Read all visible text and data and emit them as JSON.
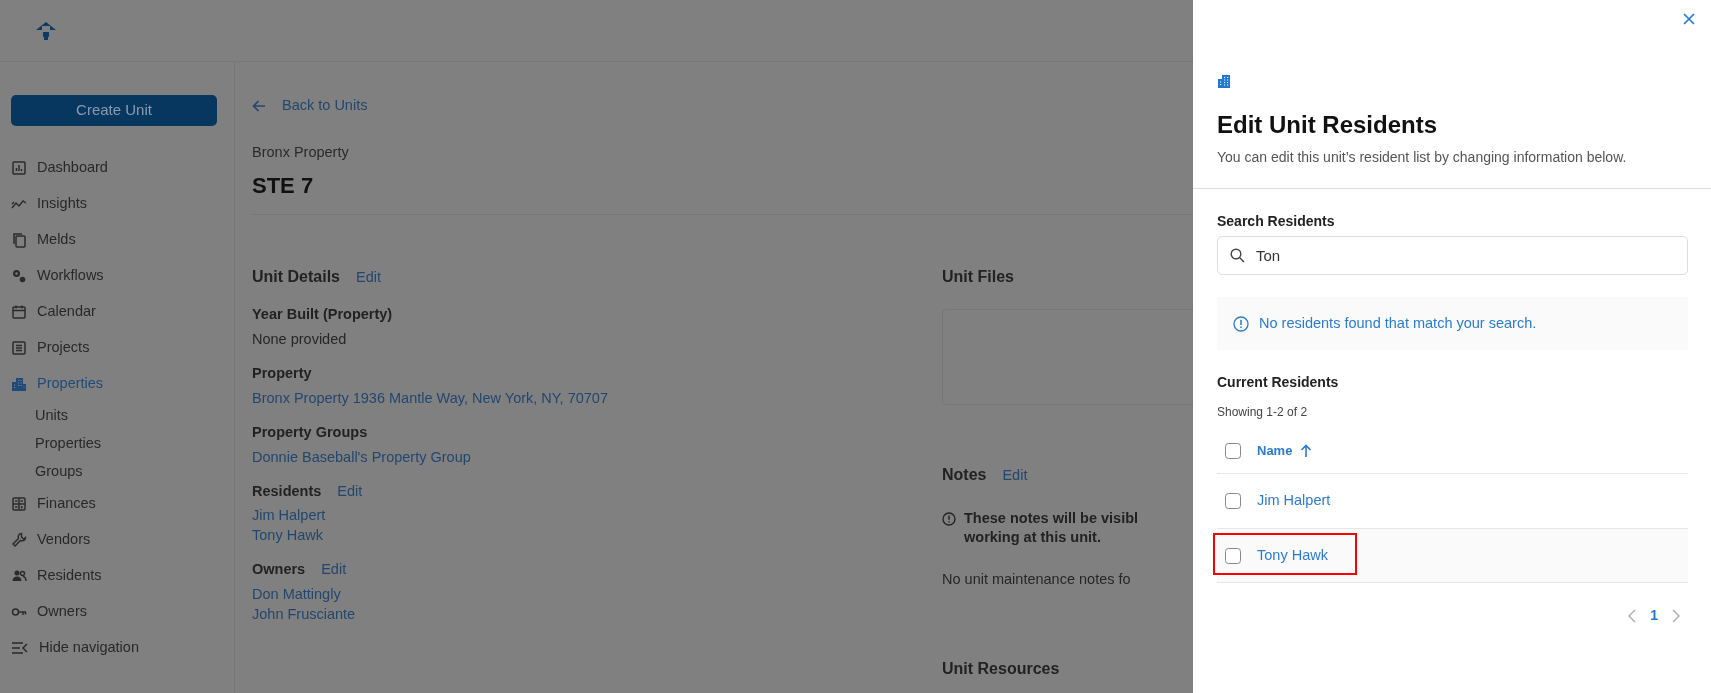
{
  "app": {
    "create_button": "Create Unit",
    "nav": [
      {
        "label": "Dashboard",
        "selected": false
      },
      {
        "label": "Insights",
        "selected": false
      },
      {
        "label": "Melds",
        "selected": false
      },
      {
        "label": "Workflows",
        "selected": false
      },
      {
        "label": "Calendar",
        "selected": false
      },
      {
        "label": "Projects",
        "selected": false
      },
      {
        "label": "Properties",
        "selected": true,
        "children": [
          {
            "label": "Units",
            "selected": false
          },
          {
            "label": "Properties",
            "selected": false
          },
          {
            "label": "Groups",
            "selected": false
          }
        ]
      },
      {
        "label": "Finances",
        "selected": false
      },
      {
        "label": "Vendors",
        "selected": false
      },
      {
        "label": "Residents",
        "selected": false
      },
      {
        "label": "Owners",
        "selected": false
      }
    ],
    "hide_nav": "Hide navigation"
  },
  "page": {
    "back_link": "Back to Units",
    "property": "Bronx Property",
    "title": "STE 7",
    "unit_details": {
      "heading": "Unit Details",
      "edit": "Edit",
      "fields": [
        {
          "label": "Year Built (Property)",
          "values": [
            {
              "text": "None provided",
              "kind": "text"
            }
          ]
        },
        {
          "label": "Property",
          "values": [
            {
              "text": "Bronx Property 1936 Mantle Way, New York, NY, 70707",
              "kind": "link"
            }
          ]
        },
        {
          "label": "Property Groups",
          "values": [
            {
              "text": "Donnie Baseball's Property Group",
              "kind": "link"
            }
          ]
        },
        {
          "label": "Residents",
          "edit": "Edit",
          "values": [
            {
              "text": "Jim Halpert",
              "kind": "link"
            },
            {
              "text": "Tony Hawk",
              "kind": "link"
            }
          ]
        },
        {
          "label": "Owners",
          "edit": "Edit",
          "values": [
            {
              "text": "Don Mattingly",
              "kind": "link"
            },
            {
              "text": "John Frusciante",
              "kind": "link"
            }
          ]
        }
      ]
    },
    "unit_files": {
      "heading": "Unit Files"
    },
    "notes": {
      "heading": "Notes",
      "edit": "Edit",
      "notice": [
        "These notes will be visibl",
        "working at this unit."
      ],
      "empty": "No unit maintenance notes fo"
    },
    "unit_resources": {
      "heading": "Unit Resources"
    }
  },
  "drawer": {
    "title": "Edit Unit Residents",
    "subtitle": "You can edit this unit’s resident list by changing information below.",
    "search": {
      "label": "Search Residents",
      "value": "Ton"
    },
    "message": "No residents found that match your search.",
    "current": {
      "heading": "Current Residents",
      "showing": "Showing 1-2 of 2",
      "column": "Name",
      "sorted_ascending": true,
      "all_checked": false,
      "rows": [
        {
          "name": "Jim Halpert",
          "checked": false,
          "highlighted": false
        },
        {
          "name": "Tony Hawk",
          "checked": false,
          "highlighted": true
        }
      ],
      "pages": [
        {
          "label": "1",
          "selected": true
        }
      ]
    }
  }
}
